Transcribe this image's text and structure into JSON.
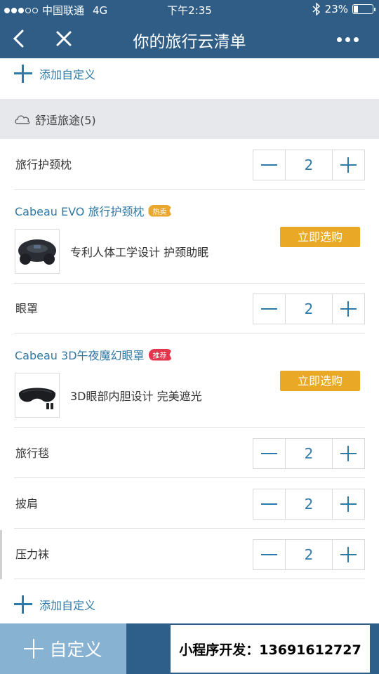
{
  "status_bar": {
    "carrier": "中国联通",
    "network": "4G",
    "time": "下午2:35",
    "battery": "23%",
    "battery_level": 0.23
  },
  "nav": {
    "title": "你的旅行云清单",
    "back_icon": "back-chevron-icon",
    "close_icon": "close-icon",
    "more_icon": "more-dots-icon"
  },
  "add_custom_label": "添加自定义",
  "section": {
    "title": "舒适旅途(5)",
    "icon": "cloud-icon"
  },
  "items": [
    {
      "name": "旅行护颈枕",
      "qty": "2"
    },
    {
      "name": "眼罩",
      "qty": "2"
    },
    {
      "name": "旅行毯",
      "qty": "2"
    },
    {
      "name": "披肩",
      "qty": "2"
    },
    {
      "name": "压力袜",
      "qty": "2"
    }
  ],
  "products": [
    {
      "name": "Cabeau EVO 旅行护颈枕",
      "tag": "热卖",
      "desc": "专利人体工学设计 护颈助眠",
      "buy": "立即选购",
      "tag_color": "#e8a830"
    },
    {
      "name": "Cabeau 3D午夜魔幻眼罩",
      "tag": "推荐",
      "desc": "3D眼部内胆设计 完美遮光",
      "buy": "立即选购",
      "tag_color": "#e2364c"
    }
  ],
  "bottom": {
    "custom_label": "自定义",
    "watermark": "小程序开发：13691612727"
  },
  "colors": {
    "primary": "#2f5d86",
    "accent_blue": "#2f79a6",
    "buy_button": "#e9a826"
  }
}
